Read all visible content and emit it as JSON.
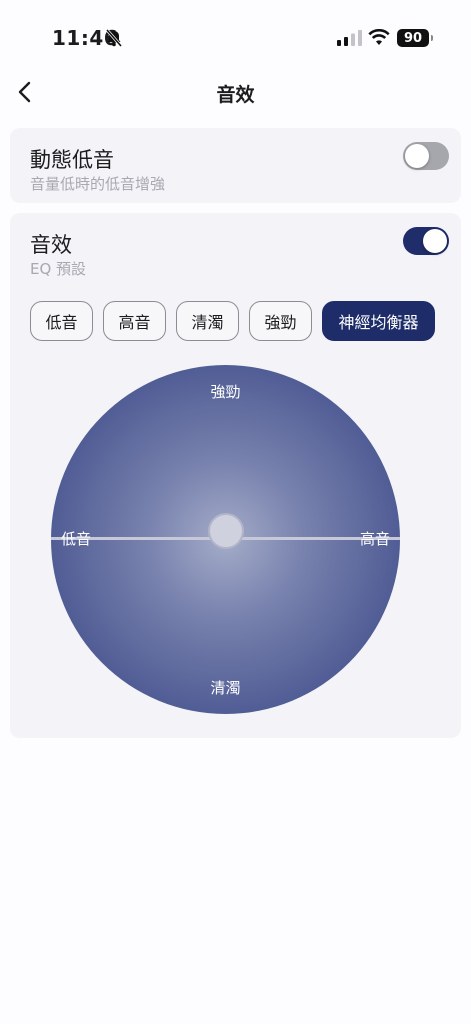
{
  "status_bar": {
    "time": "11:46",
    "battery": "90",
    "icons": [
      "bell-slash-icon",
      "signal-icon",
      "wifi-icon",
      "battery-icon"
    ]
  },
  "nav": {
    "back_icon": "chevron-left-icon",
    "title": "音效"
  },
  "dynamic_bass": {
    "title": "動態低音",
    "subtitle": "音量低時的低音增強",
    "enabled": false
  },
  "sound_effect": {
    "title": "音效",
    "subtitle": "EQ 預設",
    "enabled": true,
    "presets": [
      "低音",
      "高音",
      "清濁",
      "強勁",
      "神經均衡器"
    ],
    "selected_preset": "神經均衡器",
    "eq_pad": {
      "top_label": "強勁",
      "bottom_label": "清濁",
      "left_label": "低音",
      "right_label": "高音"
    }
  },
  "colors": {
    "accent": "#1e2d6a",
    "toggle_off": "#a6a7ac",
    "card_bg": "#f4f3f8"
  }
}
